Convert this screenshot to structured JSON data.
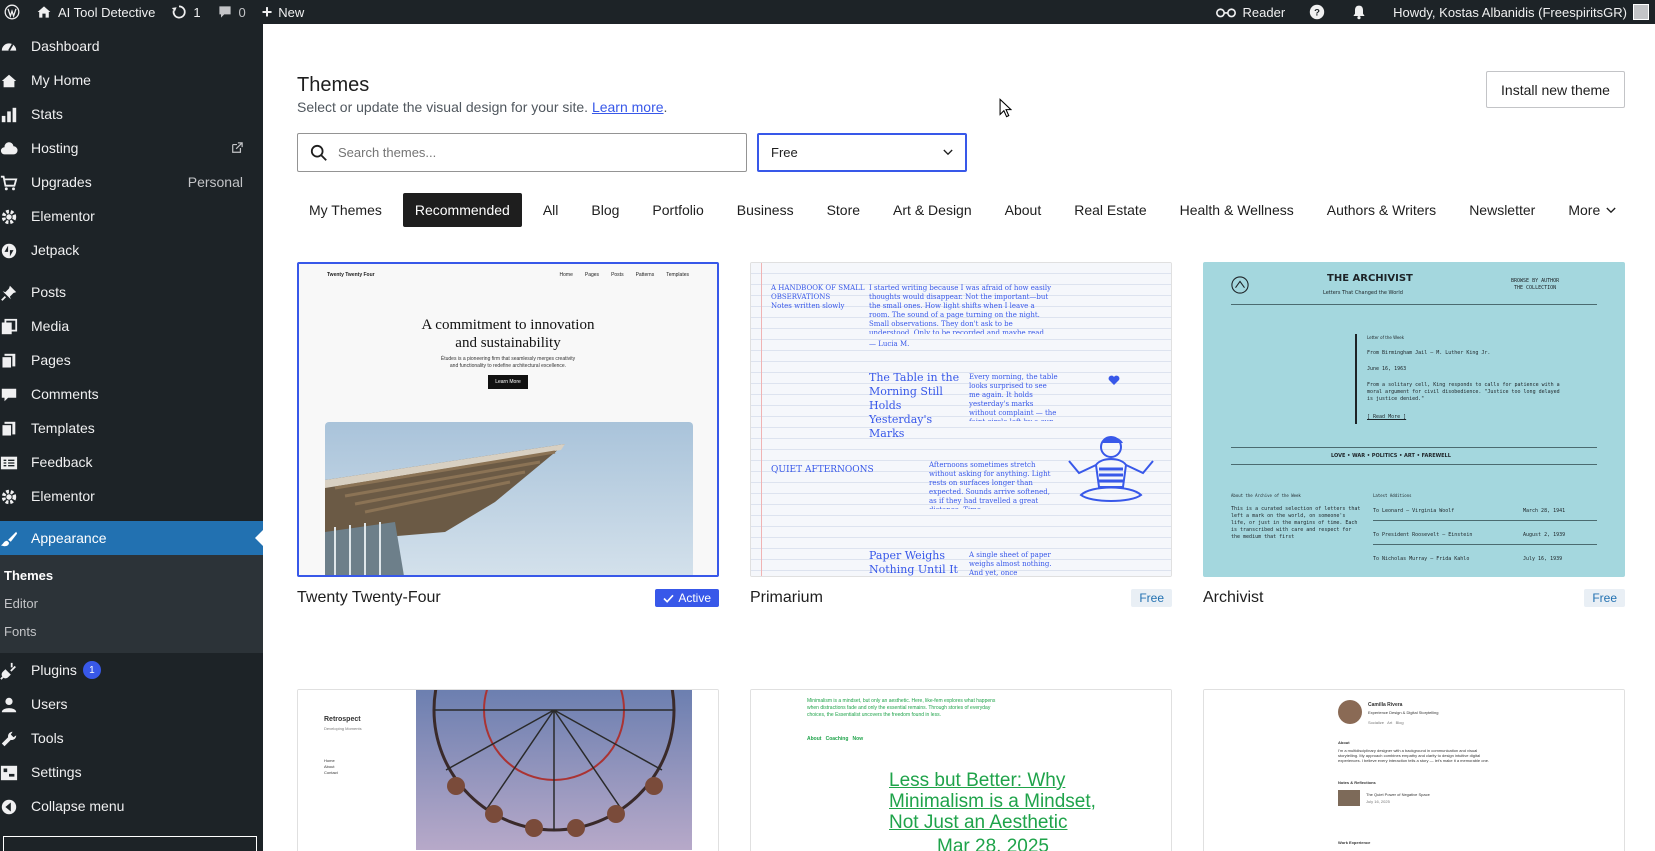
{
  "adminbar": {
    "site_name": "AI Tool Detective",
    "updates_count": "1",
    "comments_count": "0",
    "new_label": "New",
    "reader_label": "Reader",
    "howdy": "Howdy, Kostas Albanidis (FreespiritsGR)"
  },
  "sidebar": {
    "items": [
      {
        "label": "Dashboard",
        "icon": "dashboard-icon"
      },
      {
        "label": "My Home",
        "icon": "home-icon"
      },
      {
        "label": "Stats",
        "icon": "stats-icon"
      },
      {
        "label": "Hosting",
        "icon": "cloud-icon"
      },
      {
        "label": "Upgrades",
        "extra": "Personal",
        "icon": "cart-icon"
      },
      {
        "label": "Elementor",
        "icon": "gear-icon"
      },
      {
        "label": "Jetpack",
        "icon": "jetpack-icon"
      },
      {
        "label": "Posts",
        "icon": "pin-icon"
      },
      {
        "label": "Media",
        "icon": "media-icon"
      },
      {
        "label": "Pages",
        "icon": "pages-icon"
      },
      {
        "label": "Comments",
        "icon": "comment-icon"
      },
      {
        "label": "Templates",
        "icon": "templates-icon"
      },
      {
        "label": "Feedback",
        "icon": "feedback-icon"
      },
      {
        "label": "Elementor",
        "icon": "gear-icon"
      },
      {
        "label": "Appearance",
        "icon": "brush-icon"
      }
    ],
    "submenu": [
      "Themes",
      "Editor",
      "Fonts"
    ],
    "items2": [
      {
        "label": "Plugins",
        "badge": "1",
        "icon": "plug-icon"
      },
      {
        "label": "Users",
        "icon": "users-icon"
      },
      {
        "label": "Tools",
        "icon": "wrench-icon"
      },
      {
        "label": "Settings",
        "icon": "settings-icon"
      },
      {
        "label": "Collapse menu",
        "icon": "collapse-icon"
      }
    ]
  },
  "header": {
    "title": "Themes",
    "subtitle": "Select or update the visual design for your site.",
    "learn_more": "Learn more",
    "install_button": "Install new theme"
  },
  "search": {
    "placeholder": "Search themes...",
    "value": ""
  },
  "filter": {
    "selected": "Free"
  },
  "tabs": [
    "My Themes",
    "Recommended",
    "All",
    "Blog",
    "Portfolio",
    "Business",
    "Store",
    "Art & Design",
    "About",
    "Real Estate",
    "Health & Wellness",
    "Authors & Writers",
    "Newsletter",
    "More"
  ],
  "themes": [
    {
      "name": "Twenty Twenty-Four",
      "status": "Active"
    },
    {
      "name": "Primarium",
      "status": "Free"
    },
    {
      "name": "Archivist",
      "status": "Free"
    }
  ],
  "previews": {
    "t24": {
      "brand": "Twenty Twenty Four",
      "nav": [
        "Home",
        "Pages",
        "Posts",
        "Patterns",
        "Templates"
      ],
      "headline_1": "A commitment to innovation",
      "headline_2": "and sustainability",
      "body_1": "Études is a pioneering firm that seamlessly merges creativity",
      "body_2": "and functionality to redefine architectural excellence.",
      "button": "Learn More"
    },
    "prim": {
      "label_1": "A HANDBOOK OF SMALL",
      "label_2": "OBSERVATIONS",
      "label_3": "Notes written slowly",
      "intro": "I started writing because I was afraid of how easily thoughts would disappear. Not the important—but the small ones. How light shifts when I leave a room. The sound of a page turning on the night. Small observations. They don't ask to be understood. Only to be recorded and maybe read, slowly.",
      "signature": "— Lucia M.",
      "post_1": "The Table in the Morning Still Holds Yesterday's Marks",
      "post_1_text": "Every morning, the table looks surprised to see me again. It holds yesterday's marks without complaint — the faint circle left by a cup, a...",
      "section": "QUIET AFTERNOONS",
      "section_text": "Afternoons sometimes stretch without asking for anything. Light rests on surfaces longer than expected. Sounds arrive softened, as if they had travelled a great distance. Time...",
      "post_2": "Paper Weighs Nothing Until It Is",
      "post_2_text": "A single sheet of paper weighs almost nothing. And yet, once"
    },
    "arch": {
      "title": "THE ARCHIVIST",
      "tagline": "Letters That Changed the World",
      "browse": "BROWSE BY AUTHOR",
      "collection": "THE COLLECTION",
      "letter_of_week": "Letter of the Week",
      "letter_title": "From Birmingham Jail — M. Luther King Jr.",
      "letter_date": "June 16, 1963",
      "letter_text": "From a solitary cell, King responds to calls for patience with a moral argument for civil disobedience. \"Justice too long delayed is justice denied.\"",
      "read_more": "[ Read More ]",
      "nav": "LOVE  •  WAR  •  POLITICS  •  ART  •  FAREWELL",
      "about_title": "About the Archive of the Week",
      "about_text": "This is a curated selection of letters that left a mark on the world, on someone's life, or just in the margins of time. Each is transcribed with care and respect for the medium that first",
      "recent": "Latest Additions",
      "rows": [
        {
          "to": "To Leonard — Virginia Woolf",
          "date": "March 28, 1941"
        },
        {
          "to": "To President Roosevelt — Einstein",
          "date": "August 2, 1939"
        },
        {
          "to": "To Nicholas Murray — Frida Kahlo",
          "date": "July 16, 1939"
        }
      ]
    },
    "retro": {
      "title": "Retrospect",
      "subtitle": "Developing Moments",
      "nav": [
        "Home",
        "About",
        "Contact"
      ]
    },
    "ess": {
      "intro": "Minimalism is a mindset, but only an aesthetic. Here, like-fem explores what happens when distractions fade and only the essential remains. Through stories of everyday choices, the Essentialist uncovers the freedom found in less.",
      "nav": "About   Coaching   Now",
      "headline": "Less but Better: Why Minimalism is a Mindset, Not Just an Aesthetic",
      "date": "Mar 28, 2025"
    },
    "cam": {
      "name": "Camilla Rivera",
      "role": "Experience Design & Digital Storytelling",
      "links": "Socialize   Art   Blog",
      "about_label": "About",
      "about": "I'm a multidisciplinary designer with a background in communication and visual storytelling. My approach combines empathy and clarity to design intuitive digital experiences. I believe every interaction tells a story — let's make it a memorable one.",
      "notes_label": "Notes & Reflections",
      "note_title": "The Quiet Power of Negative Space",
      "note_date": "July 16, 2025",
      "work_label": "Work Experience"
    }
  },
  "colors": {
    "admin_bg": "#1d2327",
    "accent": "#3858e9",
    "current_menu": "#2271b1",
    "archivist_bg": "#a4d7de",
    "essentialist_green": "#1fa34a"
  }
}
